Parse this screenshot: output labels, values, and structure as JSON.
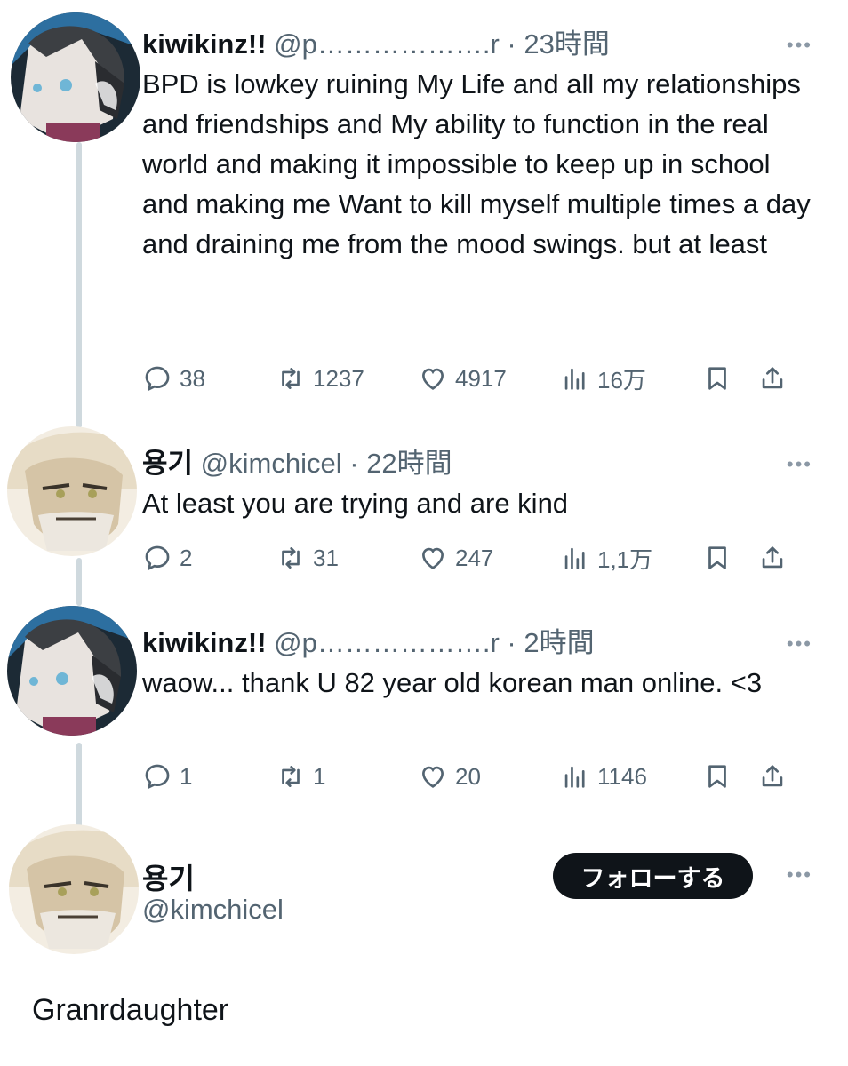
{
  "tweets": [
    {
      "name": "kiwikinz!!",
      "handle": "@p……………….r",
      "time": "23時間",
      "text": "BPD is lowkey ruining My Life and all my relationships and friendships and My ability to function in the real world and making it impossible to keep up in school  and making me Want to kill myself multiple times a day and draining me from the mood swings. but at least",
      "replies": "38",
      "retweets": "1237",
      "likes": "4917",
      "views": "16万"
    },
    {
      "name": "용기",
      "handle": "@kimchicel",
      "time": "22時間",
      "text": "At least you are trying and are kind",
      "replies": "2",
      "retweets": "31",
      "likes": "247",
      "views": "1,1万"
    },
    {
      "name": "kiwikinz!!",
      "handle": "@p……………….r",
      "time": "2時間",
      "text": "waow... thank U 82 year old korean man online. <3",
      "replies": "1",
      "retweets": "1",
      "likes": "20",
      "views": "1146"
    }
  ],
  "profile": {
    "name": "용기",
    "handle": "@kimchicel",
    "follow_label": "フォローする",
    "bio": "Granrdaughter"
  },
  "ui": {
    "dot": "·",
    "more": "•••"
  },
  "icons": {
    "reply": "reply-icon",
    "retweet": "retweet-icon",
    "like": "heart-icon",
    "views": "views-icon",
    "bookmark": "bookmark-icon",
    "share": "share-icon",
    "more": "more-icon"
  },
  "colors": {
    "text": "#0f1419",
    "secondary": "#536471",
    "thread_line": "#cfd9de",
    "button": "#0f1419"
  }
}
